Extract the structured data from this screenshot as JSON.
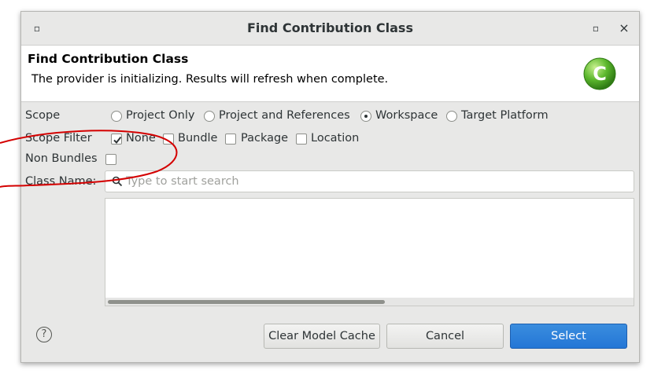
{
  "window": {
    "title": "Find Contribution Class",
    "menu_glyph": "▫",
    "maximize_glyph": "▫",
    "close_glyph": "×"
  },
  "header": {
    "title": "Find Contribution Class",
    "message": "The provider is initializing.  Results will refresh when complete.",
    "logo_letter": "C",
    "logo_color": "#5cb82d"
  },
  "scope": {
    "label": "Scope",
    "options": [
      {
        "label": "Project Only",
        "selected": false
      },
      {
        "label": "Project and References",
        "selected": false
      },
      {
        "label": "Workspace",
        "selected": true
      },
      {
        "label": "Target Platform",
        "selected": false
      }
    ]
  },
  "scope_filter": {
    "label": "Scope Filter",
    "options": [
      {
        "label": "None",
        "checked": true
      },
      {
        "label": "Bundle",
        "checked": false
      },
      {
        "label": "Package",
        "checked": false
      },
      {
        "label": "Location",
        "checked": false
      }
    ]
  },
  "non_bundles": {
    "label": "Non Bundles",
    "checked": false
  },
  "class_name": {
    "label": "Class Name:",
    "value": "",
    "placeholder": "Type to start search"
  },
  "buttons": {
    "help_glyph": "?",
    "clear_cache": "Clear Model Cache",
    "cancel": "Cancel",
    "select": "Select"
  },
  "colors": {
    "accent": "#2a7fd9",
    "annotation": "#d40000"
  }
}
